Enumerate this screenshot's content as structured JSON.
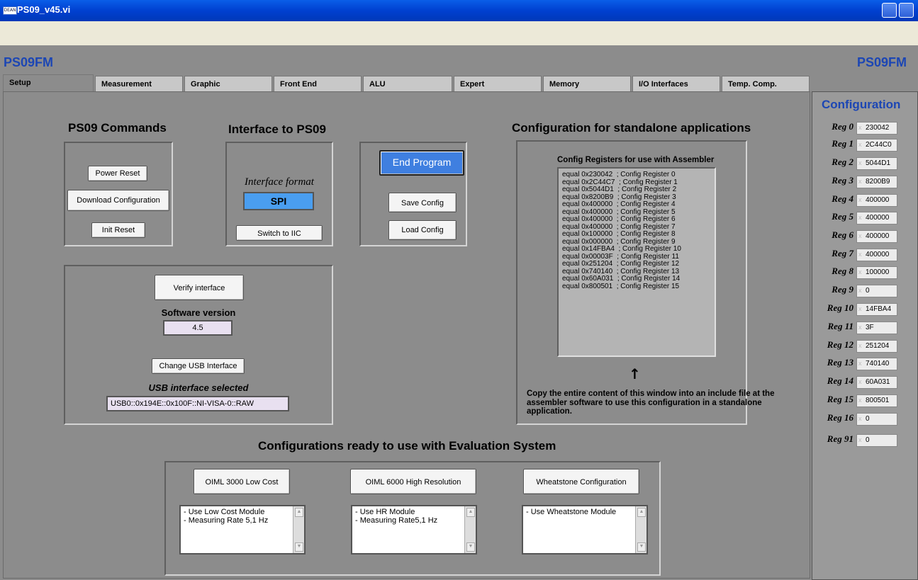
{
  "window": {
    "title": "PS09_v45.vi",
    "icon_label": "DEAN"
  },
  "brand": {
    "left": "PS09FM",
    "right": "PS09FM"
  },
  "tabs": [
    "Setup",
    "Measurement",
    "Graphic",
    "Front End",
    "ALU",
    "Expert",
    "Memory",
    "I/O Interfaces",
    "Temp. Comp."
  ],
  "commands": {
    "heading": "PS09 Commands",
    "power_reset": "Power Reset",
    "download_config": "Download Configuration",
    "init_reset": "Init Reset"
  },
  "interface": {
    "heading": "Interface to PS09",
    "format_label": "Interface format",
    "format_value": "SPI",
    "switch_button": "Switch to IIC"
  },
  "program": {
    "end_program": "End Program",
    "save_config": "Save Config",
    "load_config": "Load Config"
  },
  "verify": {
    "verify_button": "Verify interface",
    "software_version_label": "Software version",
    "software_version": "4.5",
    "change_usb_button": "Change USB Interface",
    "usb_selected_label": "USB interface selected",
    "usb_selected_value": "USB0::0x194E::0x100F::NI-VISA-0::RAW"
  },
  "standalone": {
    "heading": "Configuration for standalone applications",
    "registers_title": "Config Registers for use with Assembler",
    "lines": [
      "equal 0x230042  ; Config Register 0",
      "equal 0x2C44C7  ; Config Register 1",
      "equal 0x5044D1  ; Config Register 2",
      "equal 0x8200B9  ; Config Register 3",
      "equal 0x400000  ; Config Register 4",
      "equal 0x400000  ; Config Register 5",
      "equal 0x400000  ; Config Register 6",
      "equal 0x400000  ; Config Register 7",
      "equal 0x100000  ; Config Register 8",
      "equal 0x000000  ; Config Register 9",
      "equal 0x14FBA4  ; Config Register 10",
      "equal 0x00003F  ; Config Register 11",
      "equal 0x251204  ; Config Register 12",
      "equal 0x740140  ; Config Register 13",
      "equal 0x60A031  ; Config Register 14",
      "equal 0x800501  ; Config Register 15"
    ],
    "arrow": "↑",
    "instructions": "Copy the entire content of this window into an include file at the assembler software to use this configuration in a standalone application."
  },
  "ready": {
    "heading": "Configurations ready to use with Evaluation System",
    "presets": [
      {
        "button": "OIML 3000 Low Cost",
        "lines": [
          "- Use Low Cost Module",
          "- Measuring Rate 5,1 Hz"
        ]
      },
      {
        "button": "OIML 6000 High Resolution",
        "lines": [
          "- Use HR Module",
          "- Measuring Rate5,1 Hz"
        ]
      },
      {
        "button": "Wheatstone Configuration",
        "lines": [
          "- Use Wheatstone Module"
        ]
      }
    ]
  },
  "config_panel": {
    "title": "Configuration",
    "registers": [
      {
        "label": "Reg 0",
        "value": "230042"
      },
      {
        "label": "Reg 1",
        "value": "2C44C0"
      },
      {
        "label": "Reg 2",
        "value": "5044D1"
      },
      {
        "label": "Reg 3",
        "value": "8200B9"
      },
      {
        "label": "Reg 4",
        "value": "400000"
      },
      {
        "label": "Reg 5",
        "value": "400000"
      },
      {
        "label": "Reg 6",
        "value": "400000"
      },
      {
        "label": "Reg 7",
        "value": "400000"
      },
      {
        "label": "Reg 8",
        "value": "100000"
      },
      {
        "label": "Reg 9",
        "value": "0"
      },
      {
        "label": "Reg 10",
        "value": "14FBA4"
      },
      {
        "label": "Reg 11",
        "value": "3F"
      },
      {
        "label": "Reg 12",
        "value": "251204"
      },
      {
        "label": "Reg 13",
        "value": "740140"
      },
      {
        "label": "Reg 14",
        "value": "60A031"
      },
      {
        "label": "Reg 15",
        "value": "800501"
      },
      {
        "label": "Reg 16",
        "value": "0"
      },
      {
        "label": "Reg 91",
        "value": "0"
      }
    ]
  },
  "colors": {
    "accent_blue": "#1c46b4",
    "button_blue": "#3f7fe0",
    "format_box": "#4a9ef0"
  }
}
